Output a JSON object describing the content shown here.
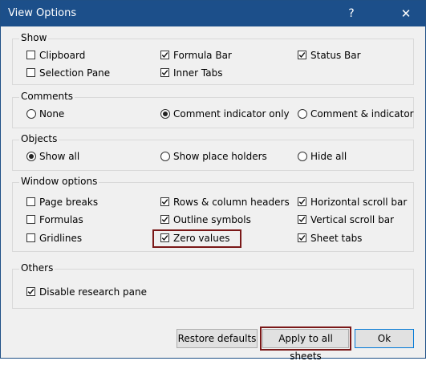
{
  "window": {
    "title": "View Options",
    "help_label": "?",
    "close_label": "✕"
  },
  "groups": {
    "show": {
      "title": "Show",
      "items": [
        {
          "label": "Clipboard",
          "checked": false
        },
        {
          "label": "Formula Bar",
          "checked": true
        },
        {
          "label": "Status Bar",
          "checked": true
        },
        {
          "label": "Selection Pane",
          "checked": false
        },
        {
          "label": "Inner Tabs",
          "checked": true
        }
      ]
    },
    "comments": {
      "title": "Comments",
      "items": [
        {
          "label": "None",
          "selected": false
        },
        {
          "label": "Comment indicator only",
          "selected": true
        },
        {
          "label": "Comment & indicator",
          "selected": false
        }
      ]
    },
    "objects": {
      "title": "Objects",
      "items": [
        {
          "label": "Show all",
          "selected": true
        },
        {
          "label": "Show place holders",
          "selected": false
        },
        {
          "label": "Hide all",
          "selected": false
        }
      ]
    },
    "window_options": {
      "title": "Window options",
      "items": [
        {
          "label": "Page breaks",
          "checked": false
        },
        {
          "label": "Rows & column headers",
          "checked": true
        },
        {
          "label": "Horizontal scroll bar",
          "checked": true
        },
        {
          "label": "Formulas",
          "checked": false
        },
        {
          "label": "Outline symbols",
          "checked": true
        },
        {
          "label": "Vertical scroll bar",
          "checked": true
        },
        {
          "label": "Gridlines",
          "checked": false
        },
        {
          "label": "Zero values",
          "checked": true
        },
        {
          "label": "Sheet tabs",
          "checked": true
        }
      ]
    },
    "others": {
      "title": "Others",
      "items": [
        {
          "label": "Disable research pane",
          "checked": true
        }
      ]
    }
  },
  "buttons": {
    "restore": "Restore defaults",
    "apply_all": "Apply to all sheets",
    "ok": "Ok"
  },
  "colors": {
    "titlebar": "#1c4f8a",
    "highlight": "#7a1818",
    "ok_border": "#0078d7"
  }
}
